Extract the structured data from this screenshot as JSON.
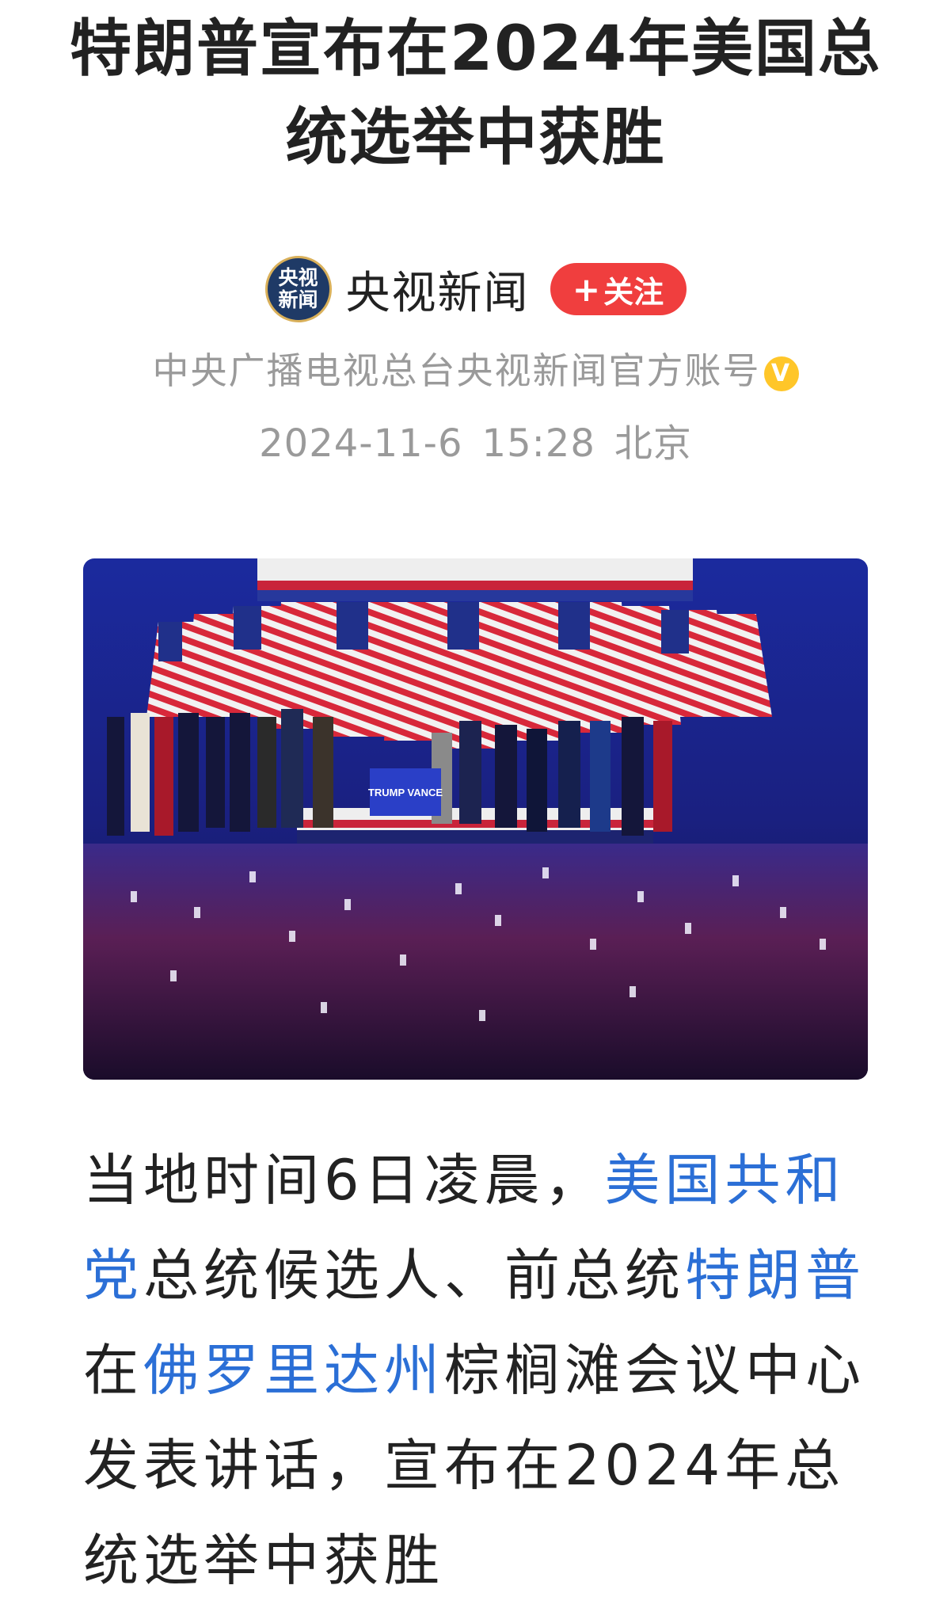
{
  "article": {
    "title": "特朗普宣布在2024年美国总统选举中获胜"
  },
  "author": {
    "avatar_text_line1": "央视",
    "avatar_text_line2": "新闻",
    "name": "央视新闻",
    "follow_label": "关注",
    "follow_icon": "plus-icon",
    "description": "中央广播电视总台央视新闻官方账号",
    "verified_icon": "verified-badge-icon",
    "verified_glyph": "V"
  },
  "meta": {
    "date": "2024-11-6",
    "time": "15:28",
    "location": "北京"
  },
  "photo": {
    "podium_text": "TRUMP VANCE"
  },
  "body": {
    "segments": [
      {
        "text": "当地时间6日凌晨，",
        "link": false
      },
      {
        "text": "美国共和党",
        "link": true
      },
      {
        "text": "总统候选人、前总统",
        "link": false
      },
      {
        "text": "特朗普",
        "link": true
      },
      {
        "text": "在",
        "link": false
      },
      {
        "text": "佛罗里达州",
        "link": true
      },
      {
        "text": "棕榈滩会议中心发表讲话，宣布在2024年总统选举中获胜",
        "link": false
      }
    ]
  },
  "colors": {
    "link": "#2b6fd6",
    "follow_button": "#f03e3e",
    "muted_text": "#9a9a9a",
    "verified": "#ffc629"
  }
}
